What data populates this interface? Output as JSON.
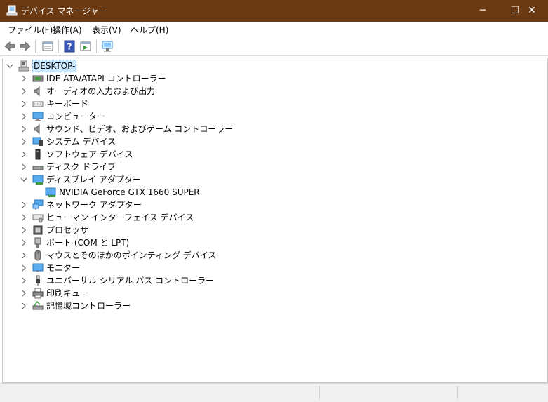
{
  "window": {
    "title": "デバイス マネージャー",
    "minimize_glyph": "─",
    "maximize_glyph": "☐",
    "close_glyph": "✕"
  },
  "menu": [
    "ファイル(F)",
    "操作(A)",
    "表示(V)",
    "ヘルプ(H)"
  ],
  "toolbar": {
    "buttons": [
      "back-arrow-icon",
      "forward-arrow-icon",
      "properties-icon",
      "help-icon",
      "update-driver-icon",
      "scan-hardware-icon"
    ]
  },
  "tree": {
    "root": {
      "label": "DESKTOP-",
      "expanded": true
    },
    "items": [
      {
        "label": "IDE ATA/ATAPI コントローラー",
        "icon": "ide-controller-icon",
        "expanded": false
      },
      {
        "label": "オーディオの入力および出力",
        "icon": "speaker-icon",
        "expanded": false
      },
      {
        "label": "キーボード",
        "icon": "keyboard-icon",
        "expanded": false
      },
      {
        "label": "コンピューター",
        "icon": "computer-icon",
        "expanded": false
      },
      {
        "label": "サウンド、ビデオ、およびゲーム コントローラー",
        "icon": "sound-icon",
        "expanded": false
      },
      {
        "label": "システム デバイス",
        "icon": "system-device-icon",
        "expanded": false
      },
      {
        "label": "ソフトウェア デバイス",
        "icon": "software-device-icon",
        "expanded": false
      },
      {
        "label": "ディスク ドライブ",
        "icon": "disk-drive-icon",
        "expanded": false
      },
      {
        "label": "ディスプレイ アダプター",
        "icon": "display-adapter-icon",
        "expanded": true,
        "children": [
          {
            "label": "NVIDIA GeForce GTX 1660 SUPER",
            "icon": "display-adapter-icon"
          }
        ]
      },
      {
        "label": "ネットワーク アダプター",
        "icon": "network-adapter-icon",
        "expanded": false
      },
      {
        "label": "ヒューマン インターフェイス デバイス",
        "icon": "hid-icon",
        "expanded": false
      },
      {
        "label": "プロセッサ",
        "icon": "processor-icon",
        "expanded": false
      },
      {
        "label": "ポート (COM と LPT)",
        "icon": "port-icon",
        "expanded": false
      },
      {
        "label": "マウスとそのほかのポインティング デバイス",
        "icon": "mouse-icon",
        "expanded": false
      },
      {
        "label": "モニター",
        "icon": "monitor-icon",
        "expanded": false
      },
      {
        "label": "ユニバーサル シリアル バス コントローラー",
        "icon": "usb-icon",
        "expanded": false
      },
      {
        "label": "印刷キュー",
        "icon": "printer-icon",
        "expanded": false
      },
      {
        "label": "記憶域コントローラー",
        "icon": "storage-controller-icon",
        "expanded": false
      }
    ]
  },
  "colors": {
    "titlebar": "#6b3a12",
    "selection": "#cce8ff",
    "icon_blue": "#3a8ed8",
    "icon_gray": "#7a7a7a"
  }
}
